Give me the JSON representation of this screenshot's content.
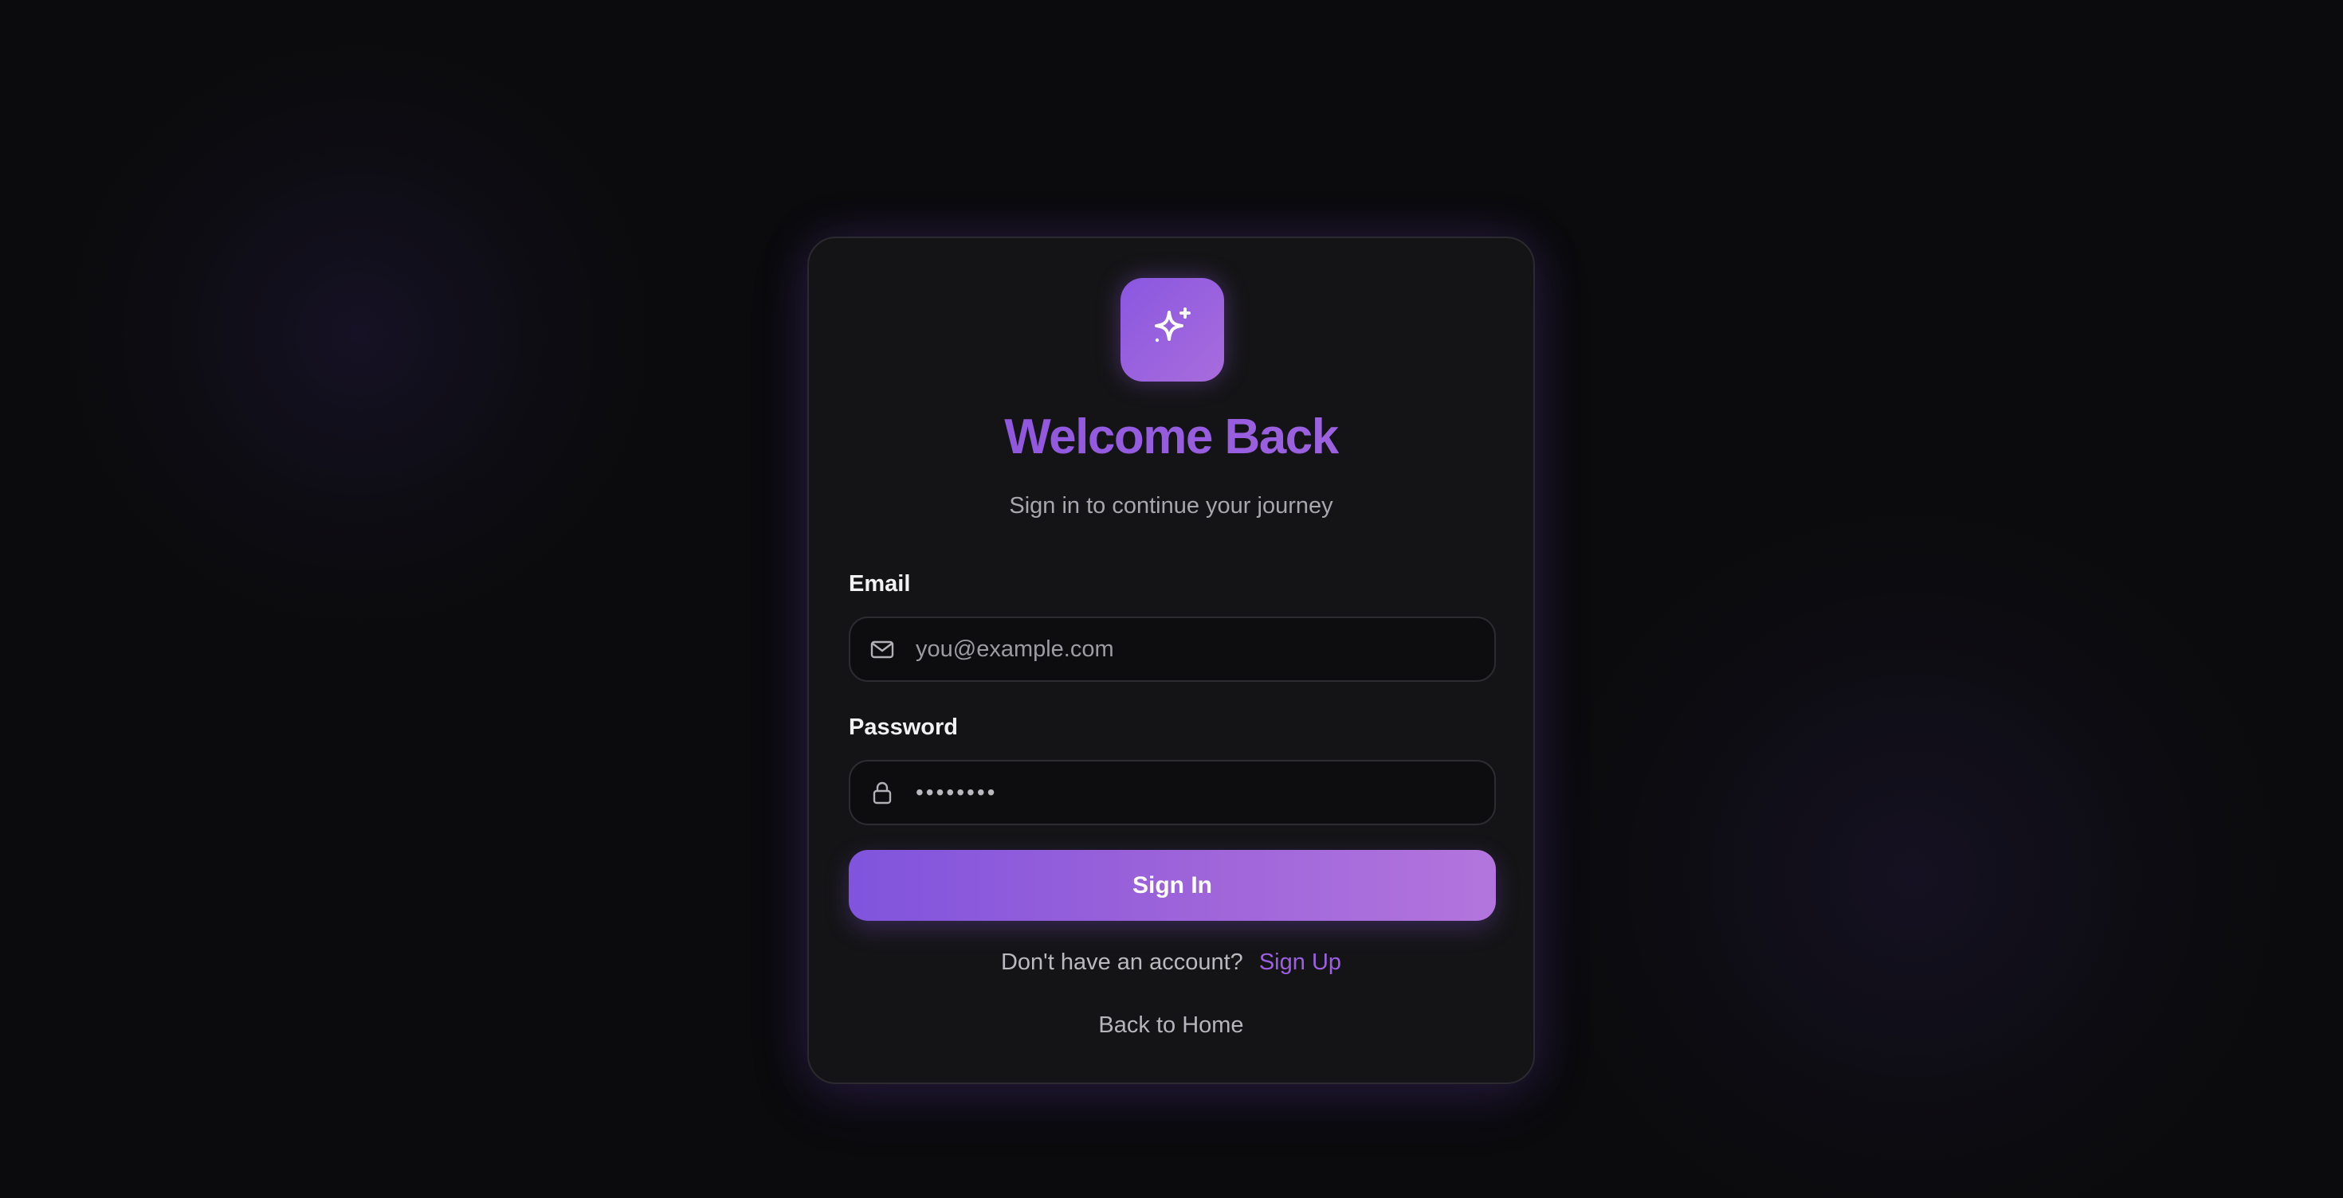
{
  "header": {
    "title": "Welcome Back",
    "subtitle": "Sign in to continue your journey",
    "logo_icon": "sparkles-icon"
  },
  "form": {
    "email": {
      "label": "Email",
      "placeholder": "you@example.com",
      "value": "",
      "icon": "mail-icon"
    },
    "password": {
      "label": "Password",
      "masked_value": "••••••••",
      "icon": "lock-icon"
    },
    "submit_label": "Sign In"
  },
  "footer": {
    "no_account_text": "Don't have an account?",
    "signup_label": "Sign Up",
    "back_home_label": "Back to Home"
  },
  "colors": {
    "accent": "#9157e0",
    "accent_light": "#b375dd",
    "background": "#0b0b0d",
    "card": "#141416"
  }
}
